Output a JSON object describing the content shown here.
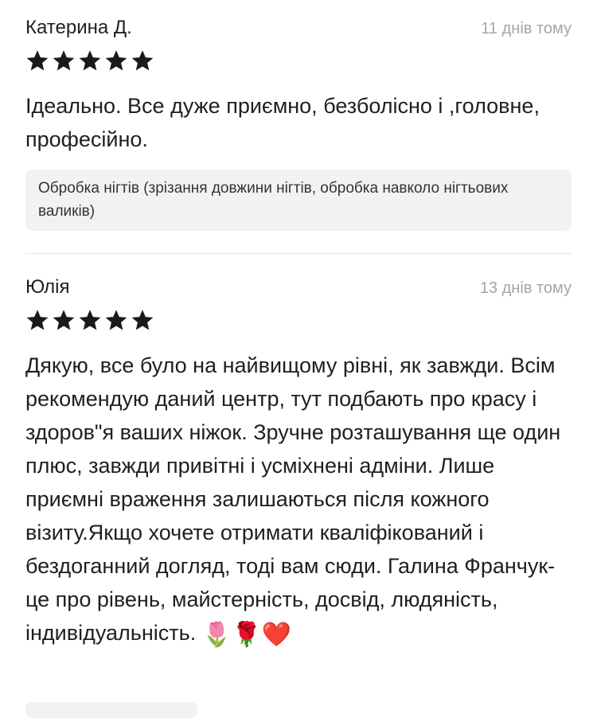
{
  "reviews": [
    {
      "author": "Катерина Д.",
      "date": "11 днів тому",
      "rating": 5,
      "text": "Ідеально. Все дуже приємно, безболісно і ,головне, професійно.",
      "service": "Обробка нігтів (зрізання довжини нігтів, обробка навколо нігтьових валиків)"
    },
    {
      "author": "Юлія",
      "date": "13 днів тому",
      "rating": 5,
      "text": "Дякую, все було на найвищому рівні, як завжди. Всім рекомендую даний центр, тут подбають про красу і здоров\"я ваших ніжок. Зручне розташування ще один плюс, завжди привітні і усміхнені адміни. Лише приємні враження залишаються після кожного візиту.Якщо хочете отримати кваліфікований і бездоганний догляд, тоді вам сюди. Галина Франчук-це про рівень, майстерність, досвід, людяність, індивідуальність.",
      "emojis": "🌷🌹❤️"
    }
  ],
  "icons": {
    "star": "star-icon"
  },
  "colors": {
    "text": "#1f1f1f",
    "date": "#a5a5a5",
    "tag_bg": "#f2f2f2",
    "star": "#1a1a1a",
    "divider": "#e4e4e4"
  }
}
